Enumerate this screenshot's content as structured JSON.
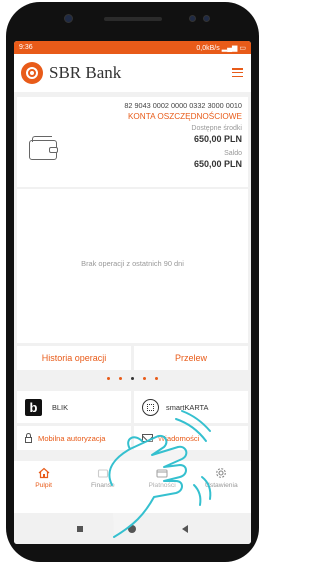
{
  "status_bar": {
    "time": "9:36",
    "network": "0,0kB/s",
    "signal": "ᵛᵒˡᵗᵉ",
    "battery_icon": "battery-icon"
  },
  "app": {
    "brand": "SBR Bank",
    "brand_color": "#e85b19",
    "menu_icon": "hamburger-icon"
  },
  "account": {
    "number": "82 9043 0002 0000 0332 3000 0010",
    "name": "KONTA OSZCZĘDNOŚCIOWE",
    "available_label": "Dostępne środki",
    "available_value": "650,00 PLN",
    "balance_label": "Saldo",
    "balance_value": "650,00 PLN",
    "icon": "wallet-icon"
  },
  "operations": {
    "empty_text": "Brak operacji z ostatnich 90 dni"
  },
  "actions": {
    "history": "Historia operacji",
    "transfer": "Przelew"
  },
  "carousel": {
    "dots": 5,
    "active_index": 1
  },
  "tiles": {
    "blik": "BLIK",
    "blik_logo": "b",
    "smartkarta": "smartKARTA",
    "mobile_auth": "Mobilna autoryzacja",
    "messages": "Wiadomości"
  },
  "bottom_nav": [
    {
      "label": "Pulpit",
      "icon": "home-icon",
      "active": true
    },
    {
      "label": "Finanse",
      "icon": "wallet-icon",
      "active": false
    },
    {
      "label": "Płatności",
      "icon": "card-icon",
      "active": false
    },
    {
      "label": "Ustawienia",
      "icon": "gear-icon",
      "active": false
    }
  ]
}
